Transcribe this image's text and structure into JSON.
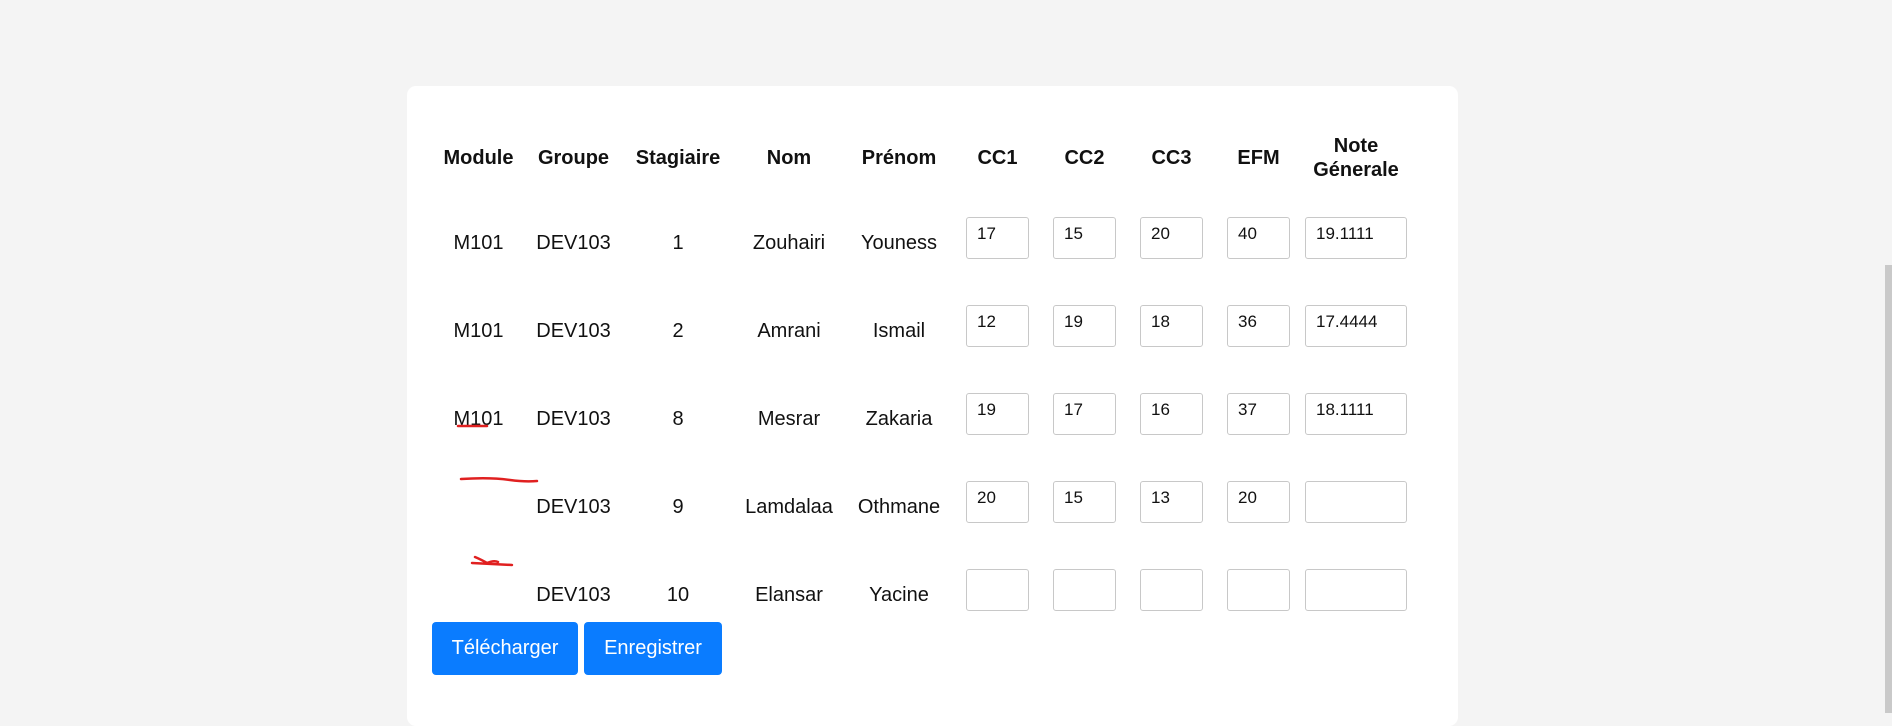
{
  "table": {
    "headers": {
      "module": "Module",
      "groupe": "Groupe",
      "stagiaire": "Stagiaire",
      "nom": "Nom",
      "prenom": "Prénom",
      "cc1": "CC1",
      "cc2": "CC2",
      "cc3": "CC3",
      "efm": "EFM",
      "note_line1": "Note",
      "note_line2": "Génerale"
    },
    "rows": [
      {
        "module": "M101",
        "groupe": "DEV103",
        "stagiaire": "1",
        "nom": "Zouhairi",
        "prenom": "Youness",
        "cc1": "17",
        "cc2": "15",
        "cc3": "20",
        "efm": "40",
        "note": "19.1111"
      },
      {
        "module": "M101",
        "groupe": "DEV103",
        "stagiaire": "2",
        "nom": "Amrani",
        "prenom": "Ismail",
        "cc1": "12",
        "cc2": "19",
        "cc3": "18",
        "efm": "36",
        "note": "17.4444"
      },
      {
        "module": "M101",
        "groupe": "DEV103",
        "stagiaire": "8",
        "nom": "Mesrar",
        "prenom": "Zakaria",
        "cc1": "19",
        "cc2": "17",
        "cc3": "16",
        "efm": "37",
        "note": "18.1111"
      },
      {
        "module": "",
        "groupe": "DEV103",
        "stagiaire": "9",
        "nom": "Lamdalaa",
        "prenom": "Othmane",
        "cc1": "20",
        "cc2": "15",
        "cc3": "13",
        "efm": "20",
        "note": ""
      },
      {
        "module": "",
        "groupe": "DEV103",
        "stagiaire": "10",
        "nom": "Elansar",
        "prenom": "Yacine",
        "cc1": "",
        "cc2": "",
        "cc3": "",
        "efm": "",
        "note": ""
      }
    ]
  },
  "buttons": {
    "download": "Télécharger",
    "save": "Enregistrer"
  },
  "colors": {
    "button_bg": "#0a7cff",
    "annotation_red": "#e02020",
    "page_bg": "#f4f4f4"
  }
}
